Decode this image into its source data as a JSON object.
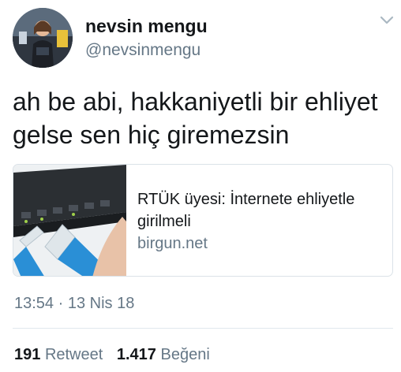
{
  "tweet": {
    "author": {
      "display_name": "nevsin mengu",
      "handle": "@nevsinmengu"
    },
    "text_lines": [
      "ah be abi, hakkaniyetli bir ehliyet",
      "gelse sen hiç giremezsin"
    ],
    "card": {
      "title_lines": [
        "RTÜK üyesi: İnternete ehliyetle",
        "girilmeli"
      ],
      "domain": "birgun.net"
    },
    "timestamp": "13:54 · 13 Nis 18",
    "stats": {
      "retweets": {
        "count": "191",
        "label": "Retweet"
      },
      "likes": {
        "count": "1.417",
        "label": "Beğeni"
      }
    }
  },
  "icons": {
    "menu": "chevron-down-icon"
  },
  "colors": {
    "text_primary": "#14171a",
    "text_secondary": "#657786",
    "border": "#dbe2e8",
    "cable_blue": "#2a8fd6"
  }
}
